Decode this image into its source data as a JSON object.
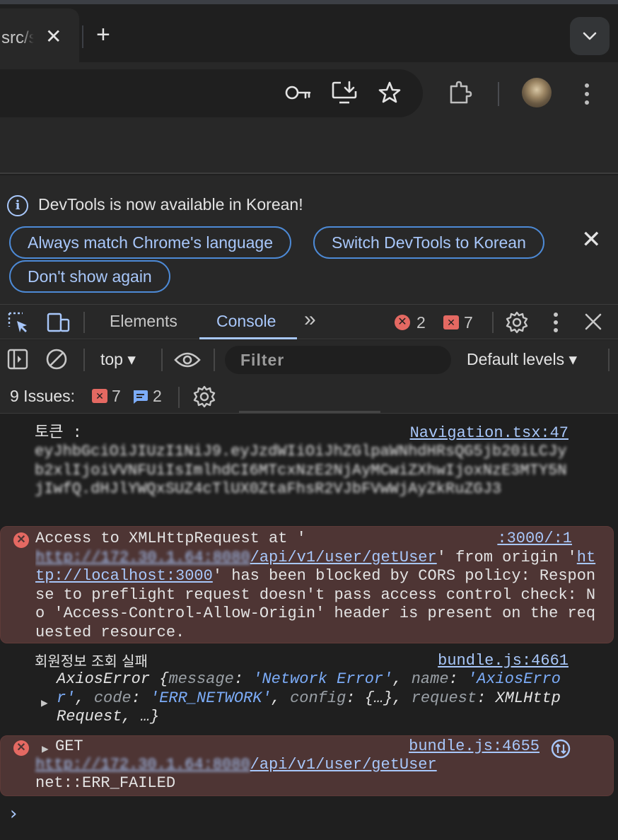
{
  "browser": {
    "tab_title": "src/s",
    "tab_close": "✕",
    "new_tab": "+"
  },
  "infobar": {
    "message": "DevTools is now available in Korean!",
    "buttons": {
      "always_match": "Always match Chrome's language",
      "switch": "Switch DevTools to Korean",
      "dont_show": "Don't show again"
    },
    "close": "✕"
  },
  "devtools": {
    "tabs": {
      "elements": "Elements",
      "console": "Console",
      "more": "»"
    },
    "error_count": "2",
    "warning_count": "7"
  },
  "console_toolbar": {
    "context": "top ▾",
    "filter_placeholder": "Filter",
    "levels": "Default levels ▾"
  },
  "issues": {
    "label": "9 Issues:",
    "warnings": "7",
    "info": "2"
  },
  "messages": {
    "m1": {
      "text": "토큰 :",
      "source": "Navigation.tsx:47",
      "token": "eyJhbGciOiJIUzI1NiJ9.eyJzdWIiOiJhZGlpaWNhdHRsQG5jb20iLCJyb2xlIjoiVVNFUiIsImlhdCI6MTcxNzE2NjAyMCwiZXhwIjoxNzE3MTY5NjIwfQ.dHJlYWQxSUZ4cTlUX0ZtaFhsR2VJbFVwWjAyZkRuZGJ3"
    },
    "m2": {
      "pre": "Access to XMLHttpRequest at '",
      "source": ":3000/:1",
      "url_host": "http://172.30.1.64:8080",
      "url_path": "/api/v1/user/getUser",
      "mid": "' from origin '",
      "origin": "http://localhost:3000",
      "post": "' has been blocked by CORS policy: Response to preflight request doesn't pass access control check: No 'Access-Control-Allow-Origin' header is present on the requested resource."
    },
    "m3": {
      "label": "회원정보 조회 실패",
      "source": "bundle.js:4661",
      "obj_name": "AxiosError ",
      "k_message": "message",
      "v_message": "'Network Error'",
      "k_name": "name",
      "v_name": "'AxiosError'",
      "k_code": "code",
      "v_code": "'ERR_NETWORK'",
      "k_config": "config",
      "v_config": "{…}",
      "k_request": "request",
      "v_request": "XMLHttpRequest, …}"
    },
    "m4": {
      "method": "GET",
      "source": "bundle.js:4655",
      "url_host": "http://172.30.1.64:8080",
      "url_path": "/api/v1/user/getUser",
      "error": "net::ERR_FAILED"
    }
  },
  "prompt": "›"
}
